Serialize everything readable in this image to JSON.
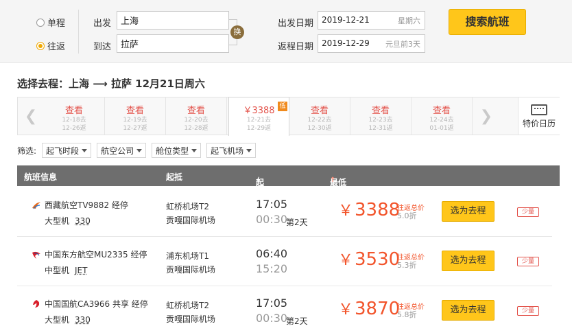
{
  "search": {
    "trip_types": [
      {
        "label": "单程",
        "checked": false
      },
      {
        "label": "往返",
        "checked": true
      }
    ],
    "from_label": "出发",
    "from_value": "上海",
    "to_label": "到达",
    "to_value": "拉萨",
    "swap_label": "换",
    "depart_date_label": "出发日期",
    "depart_date": "2019-12-21",
    "depart_weekday": "星期六",
    "return_date_label": "返程日期",
    "return_date": "2019-12-29",
    "return_note": "元旦前3天",
    "search_button": "搜索航班"
  },
  "route": {
    "title": "选择去程：上海 ⟶ 拉萨  12月21日周六"
  },
  "date_strip": {
    "days": [
      {
        "top": "查看",
        "d1": "12-18去",
        "d2": "12-26返",
        "active": false
      },
      {
        "top": "查看",
        "d1": "12-19去",
        "d2": "12-27返",
        "active": false
      },
      {
        "top": "查看",
        "d1": "12-20去",
        "d2": "12-28返",
        "active": false
      },
      {
        "top": "￥3388",
        "d1": "12-21去",
        "d2": "12-29返",
        "active": true,
        "tag": "低"
      },
      {
        "top": "查看",
        "d1": "12-22去",
        "d2": "12-30返",
        "active": false
      },
      {
        "top": "查看",
        "d1": "12-23去",
        "d2": "12-31返",
        "active": false
      },
      {
        "top": "查看",
        "d1": "12-24去",
        "d2": "01-01返",
        "active": false
      }
    ],
    "special_calendar": "特价日历"
  },
  "filters": {
    "label": "筛选:",
    "options": [
      "起飞时段",
      "航空公司",
      "舱位类型",
      "起飞机场"
    ]
  },
  "results_header": {
    "flight_info": "航班信息",
    "from_to": "起抵",
    "time": "起抵时间",
    "time_sort": "↓",
    "price": "最低价格（不含税费）",
    "price_sort": "↑"
  },
  "flights": [
    {
      "name": "西藏航空TV9882  经停",
      "aircraft": "大型机",
      "model": "330",
      "dep_airport": "虹桥机场T2",
      "arr_airport": "贡嘎国际机场",
      "dep_time": "17:05",
      "arr_time": "00:30",
      "next_day": "第2天",
      "price": "3388",
      "total_label": "往返总价",
      "discount": "5.0折",
      "button": "选为去程",
      "seats": "少量",
      "logo_color": "#e56a1c"
    },
    {
      "name": "中国东方航空MU2335  经停",
      "aircraft": "中型机",
      "model": "JET",
      "dep_airport": "浦东机场T1",
      "arr_airport": "贡嘎国际机场",
      "dep_time": "06:40",
      "arr_time": "15:20",
      "next_day": "",
      "price": "3530",
      "total_label": "往返总价",
      "discount": "5.3折",
      "button": "选为去程",
      "seats": "少量",
      "logo_color": "#d81e2a"
    },
    {
      "name": "中国国航CA3966  共享  经停",
      "aircraft": "大型机",
      "model": "330",
      "dep_airport": "虹桥机场T2",
      "arr_airport": "贡嘎国际机场",
      "dep_time": "17:05",
      "arr_time": "00:30",
      "next_day": "第2天",
      "price": "3870",
      "total_label": "往返总价",
      "discount": "5.8折",
      "button": "选为去程",
      "seats": "少量",
      "logo_color": "#d81e2a"
    }
  ],
  "currency_symbol": "￥",
  "icons": {
    "arrow_left": "chevron-left-icon",
    "arrow_right": "chevron-right-icon",
    "calendar": "calendar-icon",
    "caret": "caret-down-icon"
  }
}
